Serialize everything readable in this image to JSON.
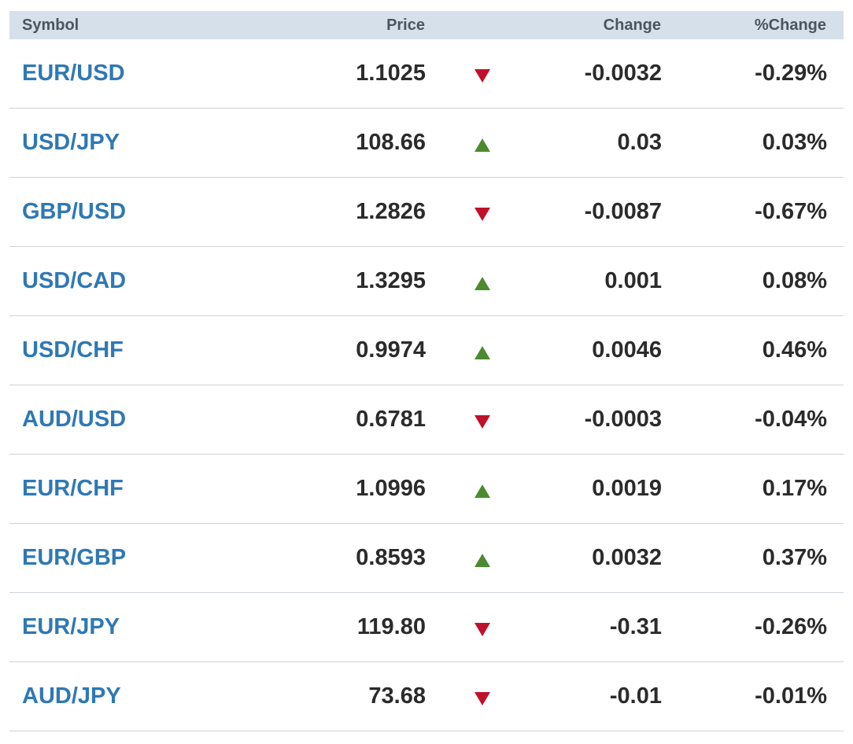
{
  "header": {
    "symbol": "Symbol",
    "price": "Price",
    "change": "Change",
    "pct_change": "%Change"
  },
  "colors": {
    "header_bg": "#d6e0ea",
    "symbol_link": "#2f78b4",
    "up": "#4c8a2f",
    "down": "#c0102a"
  },
  "rows": [
    {
      "symbol": "EUR/USD",
      "price": "1.1025",
      "direction": "down",
      "direction_icon": "down-triangle-icon",
      "change": "-0.0032",
      "pct_change": "-0.29%"
    },
    {
      "symbol": "USD/JPY",
      "price": "108.66",
      "direction": "up",
      "direction_icon": "up-triangle-icon",
      "change": "0.03",
      "pct_change": "0.03%"
    },
    {
      "symbol": "GBP/USD",
      "price": "1.2826",
      "direction": "down",
      "direction_icon": "down-triangle-icon",
      "change": "-0.0087",
      "pct_change": "-0.67%"
    },
    {
      "symbol": "USD/CAD",
      "price": "1.3295",
      "direction": "up",
      "direction_icon": "up-triangle-icon",
      "change": "0.001",
      "pct_change": "0.08%"
    },
    {
      "symbol": "USD/CHF",
      "price": "0.9974",
      "direction": "up",
      "direction_icon": "up-triangle-icon",
      "change": "0.0046",
      "pct_change": "0.46%"
    },
    {
      "symbol": "AUD/USD",
      "price": "0.6781",
      "direction": "down",
      "direction_icon": "down-triangle-icon",
      "change": "-0.0003",
      "pct_change": "-0.04%"
    },
    {
      "symbol": "EUR/CHF",
      "price": "1.0996",
      "direction": "up",
      "direction_icon": "up-triangle-icon",
      "change": "0.0019",
      "pct_change": "0.17%"
    },
    {
      "symbol": "EUR/GBP",
      "price": "0.8593",
      "direction": "up",
      "direction_icon": "up-triangle-icon",
      "change": "0.0032",
      "pct_change": "0.37%"
    },
    {
      "symbol": "EUR/JPY",
      "price": "119.80",
      "direction": "down",
      "direction_icon": "down-triangle-icon",
      "change": "-0.31",
      "pct_change": "-0.26%"
    },
    {
      "symbol": "AUD/JPY",
      "price": "73.68",
      "direction": "down",
      "direction_icon": "down-triangle-icon",
      "change": "-0.01",
      "pct_change": "-0.01%"
    }
  ]
}
